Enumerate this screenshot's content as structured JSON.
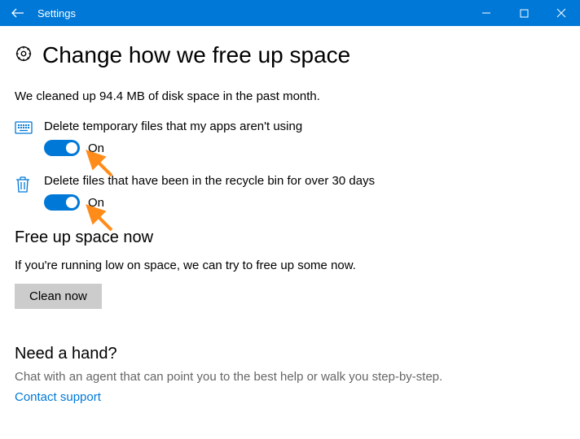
{
  "window": {
    "title": "Settings"
  },
  "page": {
    "heading": "Change how we free up space",
    "status": "We cleaned up 94.4 MB of disk space in the past month.",
    "settings": [
      {
        "label": "Delete temporary files that my apps aren't using",
        "state": "On"
      },
      {
        "label": "Delete files that have been in the recycle bin for over 30 days",
        "state": "On"
      }
    ],
    "free_up": {
      "heading": "Free up space now",
      "desc": "If you're running low on space, we can try to free up some now.",
      "button": "Clean now"
    },
    "help": {
      "heading": "Need a hand?",
      "desc": "Chat with an agent that can point you to the best help or walk you step-by-step.",
      "link": "Contact support"
    }
  }
}
